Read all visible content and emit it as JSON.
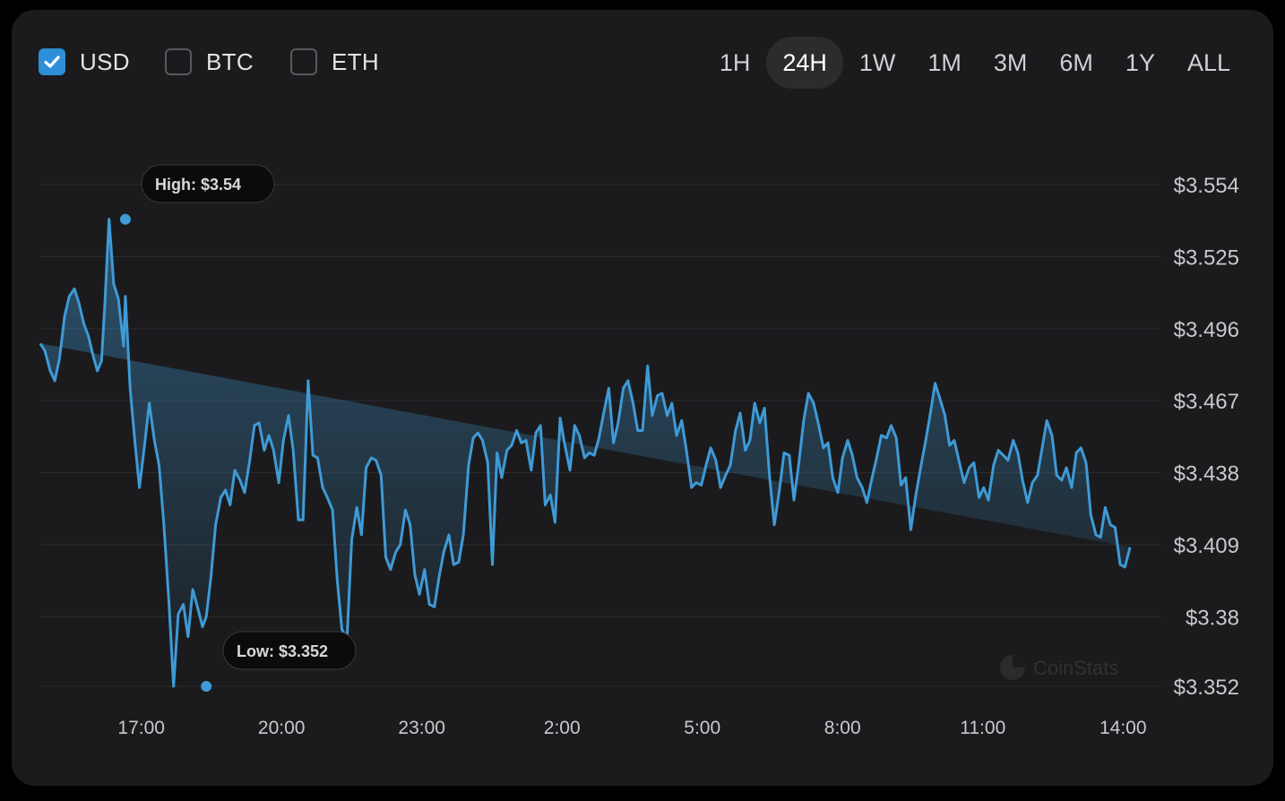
{
  "currencies": [
    {
      "label": "USD",
      "checked": true
    },
    {
      "label": "BTC",
      "checked": false
    },
    {
      "label": "ETH",
      "checked": false
    }
  ],
  "timeframes": [
    "1H",
    "24H",
    "1W",
    "1M",
    "3M",
    "6M",
    "1Y",
    "ALL"
  ],
  "active_timeframe": "24H",
  "watermark": "CoinStats",
  "colors": {
    "line": "#3f9ad6",
    "background": "#1b1b1d",
    "grid": "#2a2a2c"
  },
  "chart_data": {
    "type": "area",
    "title": "",
    "xlabel": "",
    "ylabel": "",
    "ylim": [
      3.352,
      3.554
    ],
    "y_ticks": [
      "$3.554",
      "$3.525",
      "$3.496",
      "$3.467",
      "$3.438",
      "$3.409",
      "$3.38",
      "$3.352"
    ],
    "y_tick_values": [
      3.554,
      3.525,
      3.496,
      3.467,
      3.438,
      3.409,
      3.38,
      3.352
    ],
    "x_ticks": [
      "17:00",
      "20:00",
      "23:00",
      "2:00",
      "5:00",
      "8:00",
      "11:00",
      "14:00"
    ],
    "x_tick_hours": [
      17,
      20,
      23,
      26,
      29,
      32,
      35,
      38
    ],
    "x_range_hours": [
      14.84,
      38.8
    ],
    "grid": true,
    "high": {
      "label": "High: $3.54",
      "hour": 16.66,
      "value": 3.54
    },
    "low": {
      "label": "Low: $3.352",
      "hour": 18.39,
      "value": 3.352
    },
    "series": [
      {
        "hours": [
          14.84,
          14.94,
          15.05,
          15.15,
          15.25,
          15.36,
          15.46,
          15.57,
          15.67,
          15.77,
          15.87,
          15.97,
          16.06,
          16.15,
          16.22,
          16.31,
          16.41,
          16.51,
          16.62,
          16.66,
          16.76,
          16.86,
          16.96,
          17.07,
          17.17,
          17.28,
          17.38,
          17.48,
          17.59,
          17.69,
          17.79,
          17.9,
          18.0,
          18.1,
          18.2,
          18.31,
          18.39,
          18.49,
          18.59,
          18.7,
          18.8,
          18.9,
          19.0,
          19.11,
          19.21,
          19.32,
          19.42,
          19.52,
          19.63,
          19.73,
          19.83,
          19.94,
          20.04,
          20.15,
          20.25,
          20.36,
          20.46,
          20.57,
          20.67,
          20.77,
          20.88,
          20.98,
          21.09,
          21.19,
          21.29,
          21.4,
          21.5,
          21.61,
          21.71,
          21.81,
          21.92,
          22.02,
          22.13,
          22.23,
          22.33,
          22.44,
          22.54,
          22.65,
          22.75,
          22.85,
          22.95,
          23.06,
          23.16,
          23.27,
          23.37,
          23.47,
          23.58,
          23.68,
          23.79,
          23.89,
          24.0,
          24.1,
          24.2,
          24.3,
          24.41,
          24.51,
          24.61,
          24.71,
          24.82,
          24.92,
          25.03,
          25.13,
          25.23,
          25.34,
          25.44,
          25.54,
          25.64,
          25.75,
          25.85,
          25.96,
          26.06,
          26.17,
          26.27,
          26.37,
          26.48,
          26.58,
          26.69,
          26.79,
          26.89,
          27.0,
          27.1,
          27.2,
          27.31,
          27.41,
          27.52,
          27.62,
          27.72,
          27.83,
          27.93,
          28.04,
          28.14,
          28.25,
          28.35,
          28.45,
          28.56,
          28.66,
          28.77,
          28.87,
          28.98,
          29.08,
          29.18,
          29.29,
          29.39,
          29.5,
          29.6,
          29.71,
          29.81,
          29.92,
          30.02,
          30.12,
          30.23,
          30.33,
          30.44,
          30.54,
          30.65,
          30.75,
          30.86,
          30.96,
          31.06,
          31.17,
          31.27,
          31.38,
          31.48,
          31.59,
          31.69,
          31.79,
          31.9,
          32.0,
          32.11,
          32.21,
          32.31,
          32.42,
          32.52,
          32.62,
          32.73,
          32.83,
          32.94,
          33.04,
          33.15,
          33.25,
          33.35,
          33.46,
          33.56,
          33.67,
          33.77,
          33.88,
          33.98,
          34.08,
          34.19,
          34.29,
          34.39,
          34.5,
          34.6,
          34.71,
          34.81,
          34.92,
          35.02,
          35.12,
          35.23,
          35.33,
          35.44,
          35.54,
          35.65,
          35.75,
          35.85,
          35.96,
          36.06,
          36.17,
          36.27,
          36.37,
          36.48,
          36.58,
          36.69,
          36.79,
          36.9,
          37.0,
          37.1,
          37.21,
          37.31,
          37.42,
          37.52,
          37.62,
          37.73,
          37.83,
          37.94,
          38.04,
          38.15,
          38.25,
          38.35,
          38.46,
          38.56,
          38.67,
          38.77,
          38.8
        ],
        "values": [
          3.49,
          3.487,
          3.479,
          3.475,
          3.484,
          3.501,
          3.509,
          3.512,
          3.506,
          3.498,
          3.493,
          3.485,
          3.479,
          3.483,
          3.506,
          3.54,
          3.514,
          3.508,
          3.489,
          3.509,
          3.472,
          3.451,
          3.432,
          3.449,
          3.466,
          3.451,
          3.441,
          3.418,
          3.386,
          3.352,
          3.381,
          3.385,
          3.372,
          3.391,
          3.384,
          3.376,
          3.38,
          3.396,
          3.417,
          3.428,
          3.431,
          3.425,
          3.439,
          3.435,
          3.43,
          3.443,
          3.457,
          3.458,
          3.447,
          3.453,
          3.447,
          3.434,
          3.451,
          3.461,
          3.447,
          3.419,
          3.419,
          3.475,
          3.445,
          3.444,
          3.432,
          3.428,
          3.423,
          3.395,
          3.375,
          3.371,
          3.411,
          3.424,
          3.413,
          3.44,
          3.444,
          3.443,
          3.437,
          3.404,
          3.399,
          3.406,
          3.409,
          3.423,
          3.417,
          3.397,
          3.389,
          3.399,
          3.385,
          3.384,
          3.396,
          3.406,
          3.413,
          3.401,
          3.402,
          3.413,
          3.441,
          3.452,
          3.454,
          3.451,
          3.442,
          3.401,
          3.446,
          3.436,
          3.447,
          3.449,
          3.455,
          3.45,
          3.451,
          3.439,
          3.454,
          3.457,
          3.425,
          3.429,
          3.418,
          3.46,
          3.449,
          3.439,
          3.457,
          3.453,
          3.444,
          3.446,
          3.445,
          3.452,
          3.462,
          3.472,
          3.45,
          3.458,
          3.472,
          3.475,
          3.466,
          3.455,
          3.455,
          3.481,
          3.461,
          3.469,
          3.47,
          3.461,
          3.466,
          3.453,
          3.459,
          3.447,
          3.432,
          3.434,
          3.433,
          3.441,
          3.448,
          3.443,
          3.432,
          3.437,
          3.441,
          3.455,
          3.462,
          3.447,
          3.451,
          3.466,
          3.458,
          3.464,
          3.436,
          3.417,
          3.431,
          3.446,
          3.445,
          3.427,
          3.441,
          3.459,
          3.47,
          3.466,
          3.458,
          3.448,
          3.45,
          3.436,
          3.43,
          3.444,
          3.451,
          3.445,
          3.436,
          3.432,
          3.426,
          3.435,
          3.444,
          3.453,
          3.452,
          3.457,
          3.452,
          3.433,
          3.436,
          3.415,
          3.428,
          3.44,
          3.45,
          3.462,
          3.474,
          3.468,
          3.461,
          3.449,
          3.451,
          3.442,
          3.434,
          3.44,
          3.442,
          3.428,
          3.432,
          3.427,
          3.441,
          3.447,
          3.445,
          3.443,
          3.451,
          3.446,
          3.435,
          3.426,
          3.434,
          3.437,
          3.448,
          3.459,
          3.453,
          3.437,
          3.435,
          3.44,
          3.432,
          3.446,
          3.448,
          3.442,
          3.421,
          3.413,
          3.412,
          3.424,
          3.417,
          3.416,
          3.401,
          3.4,
          3.408
        ],
        "color": "#3f9ad6"
      }
    ]
  }
}
